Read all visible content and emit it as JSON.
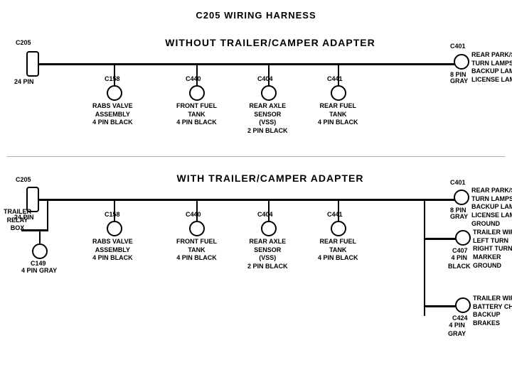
{
  "title": "C205 WIRING HARNESS",
  "section1": {
    "label": "WITHOUT  TRAILER/CAMPER ADAPTER",
    "left_connector": {
      "id": "C205",
      "pins": "24 PIN"
    },
    "right_connector": {
      "id": "C401",
      "pins": "8 PIN",
      "color": "GRAY",
      "desc": "REAR PARK/STOP\nTURN LAMPS\nBACKUP LAMPS\nLICENSE LAMPS"
    },
    "connectors": [
      {
        "id": "C158",
        "desc": "RABS VALVE\nASSEMBLY\n4 PIN BLACK"
      },
      {
        "id": "C440",
        "desc": "FRONT FUEL\nTANK\n4 PIN BLACK"
      },
      {
        "id": "C404",
        "desc": "REAR AXLE\nSENSOR\n(VSS)\n2 PIN BLACK"
      },
      {
        "id": "C441",
        "desc": "REAR FUEL\nTANK\n4 PIN BLACK"
      }
    ]
  },
  "section2": {
    "label": "WITH TRAILER/CAMPER ADAPTER",
    "left_connector": {
      "id": "C205",
      "pins": "24 PIN"
    },
    "right_connector": {
      "id": "C401",
      "pins": "8 PIN",
      "color": "GRAY",
      "desc": "REAR PARK/STOP\nTURN LAMPS\nBACKUP LAMPS\nLICENSE LAMPS\nGROUND"
    },
    "trailer_relay": {
      "label": "TRAILER\nRELAY\nBOX"
    },
    "c149": {
      "id": "C149",
      "desc": "4 PIN GRAY"
    },
    "connectors": [
      {
        "id": "C158",
        "desc": "RABS VALVE\nASSEMBLY\n4 PIN BLACK"
      },
      {
        "id": "C440",
        "desc": "FRONT FUEL\nTANK\n4 PIN BLACK"
      },
      {
        "id": "C404",
        "desc": "REAR AXLE\nSENSOR\n(VSS)\n2 PIN BLACK"
      },
      {
        "id": "C441",
        "desc": "REAR FUEL\nTANK\n4 PIN BLACK"
      }
    ],
    "right_connectors": [
      {
        "id": "C407",
        "pins": "4 PIN\nBLACK",
        "desc": "TRAILER WIRES\nLEFT TURN\nRIGHT TURN\nMARKER\nGROUND"
      },
      {
        "id": "C424",
        "pins": "4 PIN\nGRAY",
        "desc": "TRAILER WIRES\nBATTERY CHARGE\nBACKUP\nBRAKES"
      }
    ]
  }
}
